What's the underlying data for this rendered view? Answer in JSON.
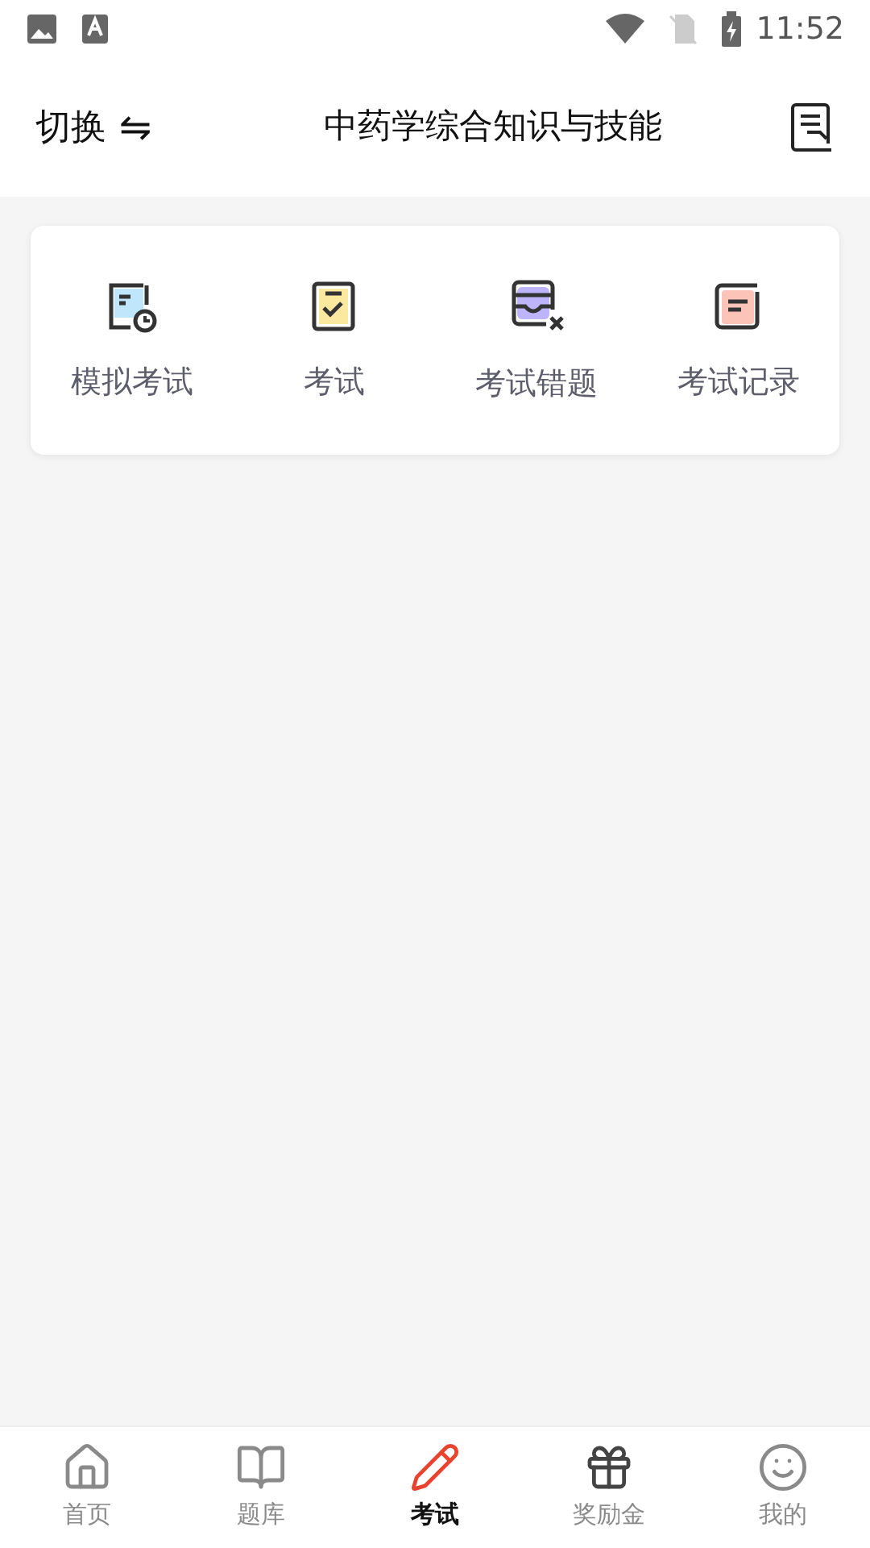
{
  "status_bar": {
    "time": "11:52"
  },
  "header": {
    "switch_label": "切换",
    "switch_icon": "⇋",
    "title": "中药学综合知识与技能"
  },
  "exam_menu": [
    {
      "kind": "mock",
      "label": "模拟考试"
    },
    {
      "kind": "exam",
      "label": "考试"
    },
    {
      "kind": "mistakes",
      "label": "考试错题"
    },
    {
      "kind": "records",
      "label": "考试记录"
    }
  ],
  "bottom_nav": [
    {
      "kind": "home",
      "label": "首页",
      "selected": false
    },
    {
      "kind": "bank",
      "label": "题库",
      "selected": false
    },
    {
      "kind": "exam",
      "label": "考试",
      "selected": true
    },
    {
      "kind": "reward",
      "label": "奖励金",
      "selected": false
    },
    {
      "kind": "me",
      "label": "我的",
      "selected": false
    }
  ]
}
